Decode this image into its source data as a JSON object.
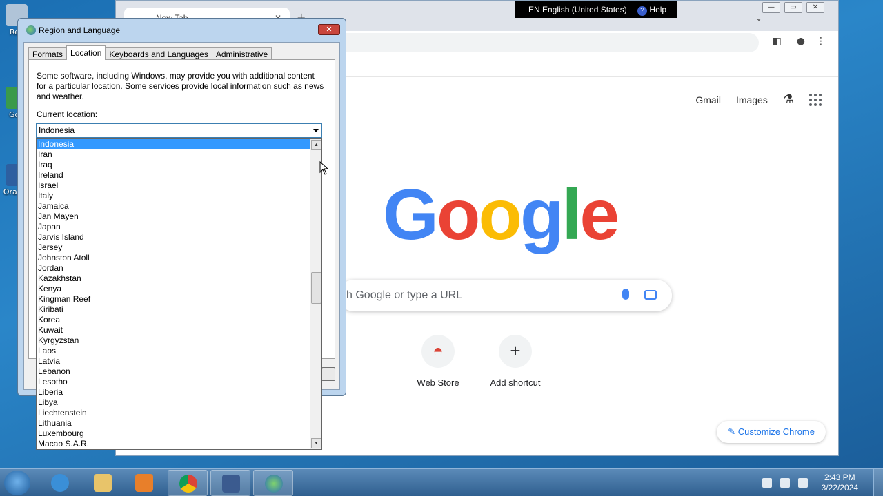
{
  "desktop": {
    "icons": [
      {
        "label": "Rec",
        "color": "#b0c4d8"
      },
      {
        "label": "Goo",
        "color": "#3a9a4b"
      },
      {
        "label": "Ora Vir",
        "color": "#2d5fa0"
      }
    ]
  },
  "chrome": {
    "tab_title": "New Tab",
    "tab_close": "✕",
    "new_tab": "+",
    "chevron": "⌄",
    "win_min": "—",
    "win_max": "▭",
    "win_close": "✕",
    "toplinks": {
      "gmail": "Gmail",
      "images": "Images"
    },
    "logo_letters": [
      {
        "ch": "G",
        "color": "#4285f4"
      },
      {
        "ch": "o",
        "color": "#ea4335"
      },
      {
        "ch": "o",
        "color": "#fbbc05"
      },
      {
        "ch": "g",
        "color": "#4285f4"
      },
      {
        "ch": "l",
        "color": "#34a853"
      },
      {
        "ch": "e",
        "color": "#ea4335"
      }
    ],
    "search_placeholder": "h Google or type a URL",
    "shortcuts": [
      {
        "label": "Web Store",
        "glyph": "◓"
      },
      {
        "label": "Add shortcut",
        "glyph": "+"
      }
    ],
    "customize": "✎ Customize Chrome"
  },
  "langbar": {
    "lang": "EN English (United States)",
    "help_icon": "?",
    "help": "Help"
  },
  "dialog": {
    "title": "Region and Language",
    "close": "✕",
    "tabs": [
      "Formats",
      "Location",
      "Keyboards and Languages",
      "Administrative"
    ],
    "active_tab": "Location",
    "description": "Some software, including Windows, may provide you with additional content for a particular location. Some services provide local information such as news and weather.",
    "current_location_label": "Current location:",
    "current_location_value": "Indonesia"
  },
  "dropdown": {
    "selected": "Indonesia",
    "items": [
      "Indonesia",
      "Iran",
      "Iraq",
      "Ireland",
      "Israel",
      "Italy",
      "Jamaica",
      "Jan Mayen",
      "Japan",
      "Jarvis Island",
      "Jersey",
      "Johnston Atoll",
      "Jordan",
      "Kazakhstan",
      "Kenya",
      "Kingman Reef",
      "Kiribati",
      "Korea",
      "Kuwait",
      "Kyrgyzstan",
      "Laos",
      "Latvia",
      "Lebanon",
      "Lesotho",
      "Liberia",
      "Libya",
      "Liechtenstein",
      "Lithuania",
      "Luxembourg",
      "Macao S.A.R."
    ],
    "scroll_up": "▲",
    "scroll_down": "▼"
  },
  "taskbar": {
    "apps": [
      {
        "name": "ie",
        "color": "#3a8fd8",
        "open": false
      },
      {
        "name": "explorer",
        "color": "#e8c46a",
        "open": false
      },
      {
        "name": "media",
        "color": "#e87f2a",
        "open": false
      },
      {
        "name": "chrome",
        "color": "#db4437",
        "open": true
      },
      {
        "name": "virtualbox",
        "color": "#3b5b8f",
        "open": true
      },
      {
        "name": "region",
        "color": "#4da04d",
        "open": true
      }
    ],
    "time": "2:43 PM",
    "date": "3/22/2024"
  }
}
